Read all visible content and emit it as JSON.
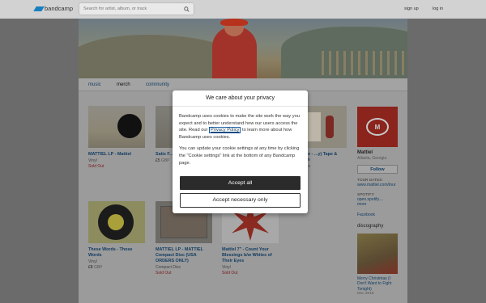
{
  "header": {
    "logo_text": "bandcamp",
    "search_placeholder": "Search for artist, album, or track",
    "signup": "sign up",
    "login": "log in"
  },
  "subnav": {
    "music": "music",
    "merch": "merch",
    "community": "community"
  },
  "albums": [
    {
      "title": "MATTIEL LP - Mattiel",
      "format": "Vinyl",
      "status": "Sold Out"
    },
    {
      "title": "Satis F...",
      "price": "£5",
      "currency": "GBP"
    },
    {
      "title": "...e Byline - ...y) Tape & ...eychain",
      "note": "...my Stairs"
    },
    {
      "title": "These Words - Those Words",
      "format": "Vinyl",
      "price": "£8",
      "currency": "GBP"
    },
    {
      "title": "MATTIEL LP - MATTIEL Compact Disc (USA ORDERS ONLY)",
      "format": "Compact Disc",
      "status": "Sold Out"
    },
    {
      "title": "Mattiel 7\" - Count Your Blessings b/w Whites of Their Eyes",
      "format": "Vinyl",
      "status": "Sold Out"
    }
  ],
  "artist": {
    "name": "Mattiel",
    "location": "Atlanta, Georgia",
    "follow": "Follow",
    "tour_label": "TOUR DATES:",
    "tour_link": "www.mattiel.com/tour",
    "spotify_label": "SPOTIFY:",
    "spotify_link": "open.spotify....",
    "more": "more",
    "facebook": "Facebook",
    "discography_label": "discography",
    "disc_title": "Merry Christmas (I Don't Want to Fight Tonight)",
    "disc_date": "Dec 2016"
  },
  "modal": {
    "title": "We care about your privacy",
    "para1_before": "Bandcamp uses cookies to make the site work the way you expect and to better understand how our users access the site. Read our ",
    "privacy_link": "Privacy Policy",
    "para1_after": " to learn more about how Bandcamp uses cookies.",
    "para2": "You can update your cookie settings at any time by clicking the \"Cookie settings\" link at the bottom of any Bandcamp page.",
    "accept_all": "Accept all",
    "accept_necessary": "Accept necessary only"
  },
  "colors": {
    "brand": "#1a7fc1",
    "accent_red": "#8a241c",
    "button_dark": "#2b2b2b"
  }
}
